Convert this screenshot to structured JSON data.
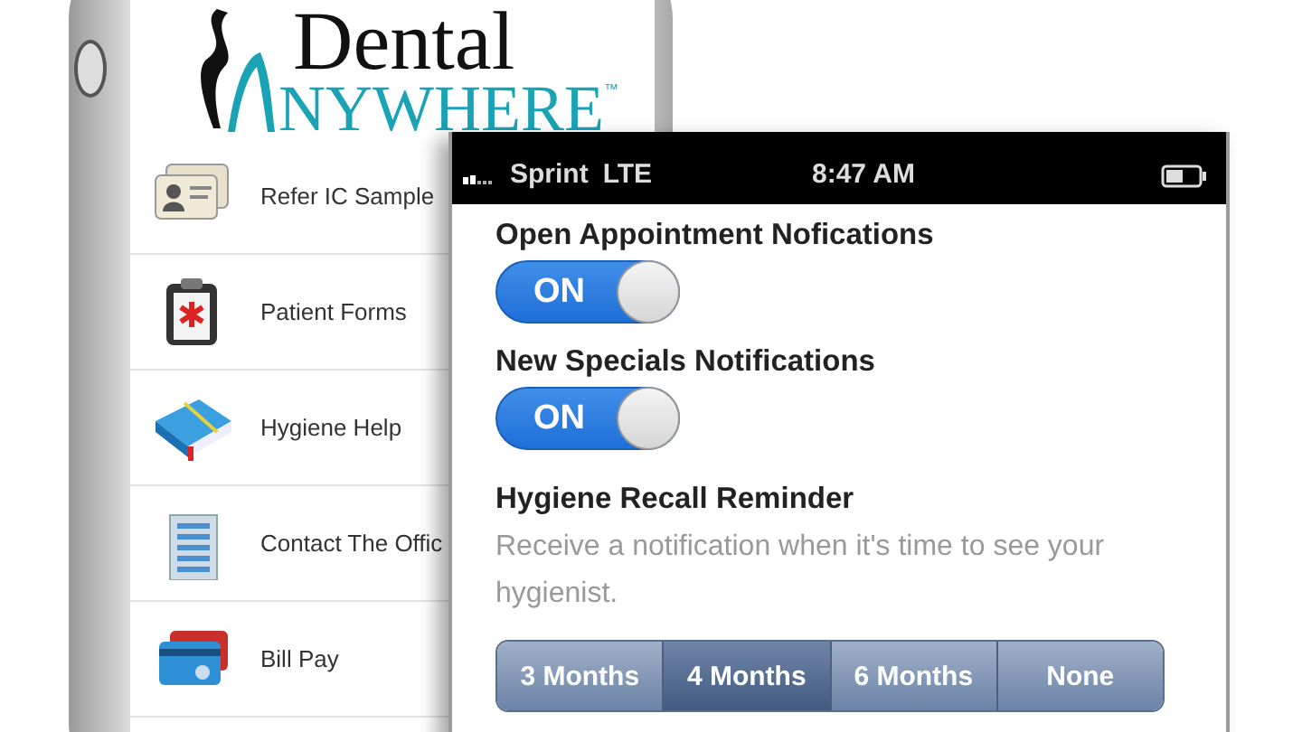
{
  "back_phone": {
    "logo": {
      "line_1": "Dental",
      "line_2": "NYWHERE",
      "trademark": "™"
    },
    "menu": [
      {
        "label": "Refer IC Sample"
      },
      {
        "label": "Patient Forms"
      },
      {
        "label": "Hygiene Help"
      },
      {
        "label": "Contact The Offic"
      },
      {
        "label": "Bill Pay"
      }
    ]
  },
  "front_phone": {
    "status_bar": {
      "carrier": "Sprint",
      "network": "LTE",
      "time": "8:47 AM"
    },
    "settings": [
      {
        "kind": "toggle",
        "title": "Open Appointment Nofications",
        "on": true,
        "switch_label": "ON"
      },
      {
        "kind": "toggle",
        "title": "New Specials Notifications",
        "on": true,
        "switch_label": "ON"
      },
      {
        "kind": "segments",
        "title": "Hygiene Recall Reminder",
        "description": "Receive a notification when it's time to see your hygienist.",
        "options": [
          {
            "label": "3 Months",
            "selected": false
          },
          {
            "label": "4 Months",
            "selected": true
          },
          {
            "label": "6 Months",
            "selected": false
          },
          {
            "label": "None",
            "selected": false
          }
        ]
      }
    ]
  }
}
